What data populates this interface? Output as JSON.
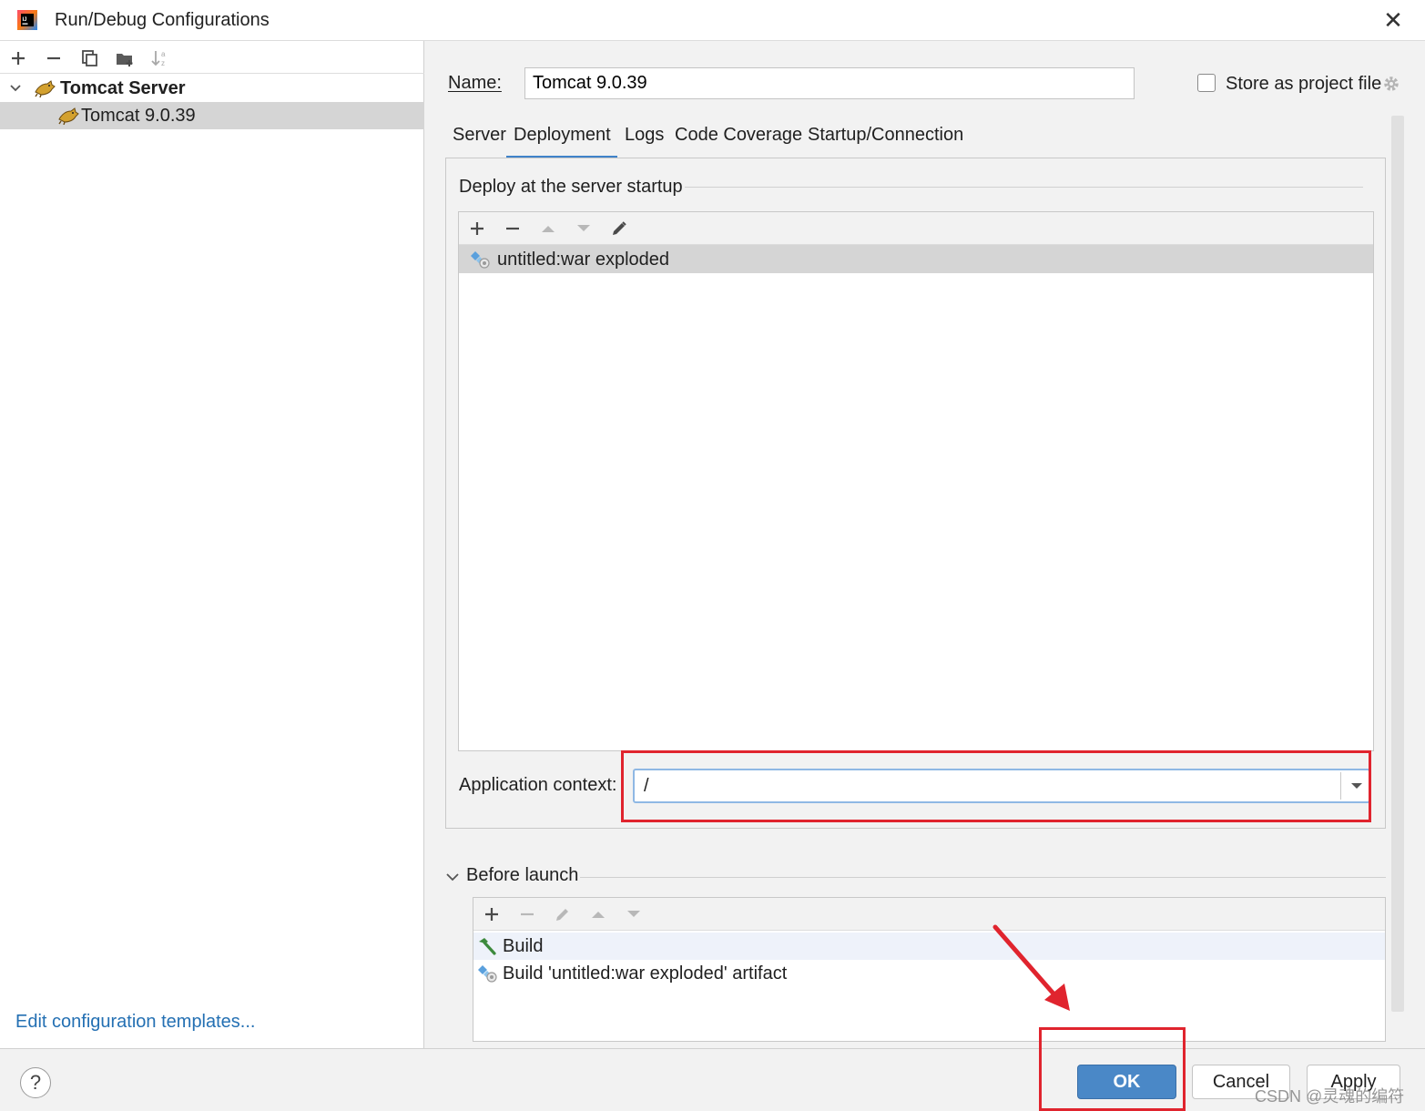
{
  "window": {
    "title": "Run/Debug Configurations",
    "close_glyph": "✕"
  },
  "left": {
    "toolbar_icons": [
      "add-icon",
      "remove-icon",
      "copy-icon",
      "new-folder-icon",
      "sort-icon"
    ],
    "tree": {
      "group_label": "Tomcat Server",
      "child_label": "Tomcat 9.0.39"
    },
    "edit_templates_link": "Edit configuration templates..."
  },
  "right": {
    "name_label": "Name:",
    "name_value": "Tomcat 9.0.39",
    "store_as_project_file": "Store as project file",
    "tabs": [
      "Server",
      "Deployment",
      "Logs",
      "Code Coverage",
      "Startup/Connection"
    ],
    "active_tab": "Deployment",
    "deploy": {
      "section_title": "Deploy at the server startup",
      "items": [
        "untitled:war exploded"
      ]
    },
    "app_context": {
      "label": "Application context:",
      "value": "/"
    },
    "before_launch": {
      "label": "Before launch",
      "items": [
        "Build",
        "Build 'untitled:war exploded' artifact"
      ]
    }
  },
  "buttons": {
    "help": "?",
    "ok": "OK",
    "cancel": "Cancel",
    "apply": "Apply"
  },
  "watermark": "CSDN @灵魂的编符",
  "colors": {
    "accent": "#4083c9",
    "ok_button": "#4a88c7",
    "annotation_red": "#e0242e",
    "link": "#2470b3"
  }
}
